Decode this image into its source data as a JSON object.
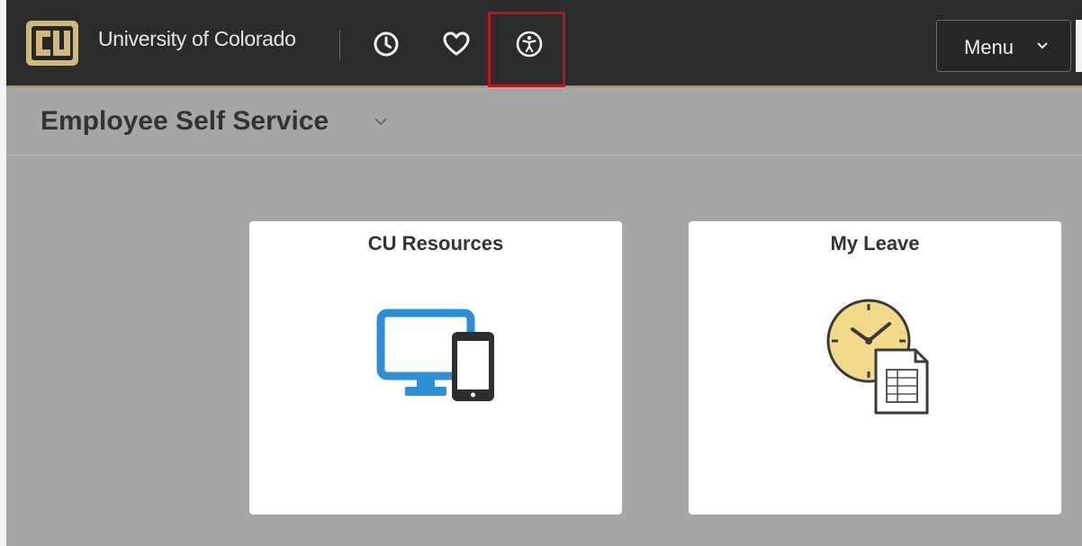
{
  "header": {
    "brand_text": "University of Colorado",
    "nav_icons": [
      "clock-icon",
      "heart-icon",
      "accessibility-icon"
    ],
    "menu_label": "Menu",
    "colors": {
      "bar": "#2b2b2b",
      "gold": "#cfb87c",
      "highlight": "#c2131b"
    }
  },
  "page": {
    "title": "Employee Self Service"
  },
  "tiles": [
    {
      "title": "CU Resources",
      "icon": "computer-phone-icon"
    },
    {
      "title": "My Leave",
      "icon": "clock-document-icon"
    }
  ]
}
